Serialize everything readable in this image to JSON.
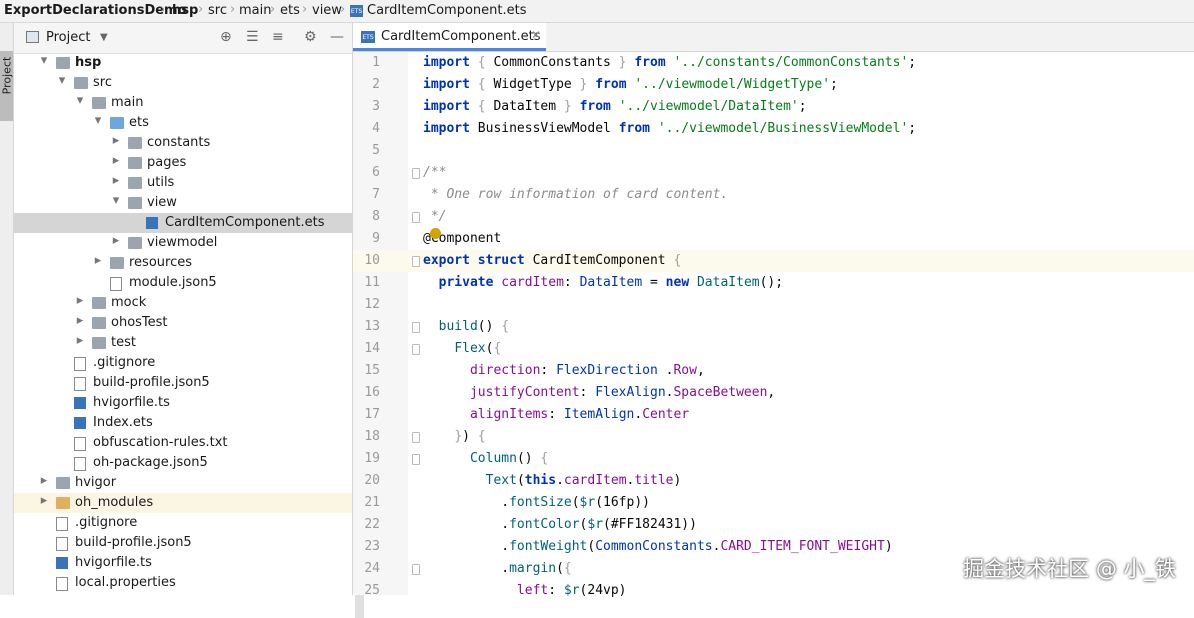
{
  "breadcrumb": [
    "ExportDeclarationsDemo",
    "hsp",
    "src",
    "main",
    "ets",
    "view",
    "CardItemComponent.ets"
  ],
  "side_strip": {
    "label": "Project"
  },
  "project_panel": {
    "title": "Project",
    "tree": [
      {
        "label": "hsp",
        "depth": 1,
        "expanded": true,
        "type": "folder",
        "bold": true
      },
      {
        "label": "src",
        "depth": 2,
        "expanded": true,
        "type": "folder"
      },
      {
        "label": "main",
        "depth": 3,
        "expanded": true,
        "type": "folder"
      },
      {
        "label": "ets",
        "depth": 4,
        "expanded": true,
        "type": "folder-blue"
      },
      {
        "label": "constants",
        "depth": 5,
        "expanded": false,
        "type": "folder"
      },
      {
        "label": "pages",
        "depth": 5,
        "expanded": false,
        "type": "folder"
      },
      {
        "label": "utils",
        "depth": 5,
        "expanded": false,
        "type": "folder"
      },
      {
        "label": "view",
        "depth": 5,
        "expanded": true,
        "type": "folder"
      },
      {
        "label": "CardItemComponent.ets",
        "depth": 6,
        "type": "ets",
        "selected": true
      },
      {
        "label": "viewmodel",
        "depth": 5,
        "expanded": false,
        "type": "folder"
      },
      {
        "label": "resources",
        "depth": 4,
        "expanded": false,
        "type": "folder"
      },
      {
        "label": "module.json5",
        "depth": 4,
        "type": "file"
      },
      {
        "label": "mock",
        "depth": 3,
        "expanded": false,
        "type": "folder"
      },
      {
        "label": "ohosTest",
        "depth": 3,
        "expanded": false,
        "type": "folder"
      },
      {
        "label": "test",
        "depth": 3,
        "expanded": false,
        "type": "folder"
      },
      {
        "label": ".gitignore",
        "depth": 2,
        "type": "file"
      },
      {
        "label": "build-profile.json5",
        "depth": 2,
        "type": "file"
      },
      {
        "label": "hvigorfile.ts",
        "depth": 2,
        "type": "ts"
      },
      {
        "label": "Index.ets",
        "depth": 2,
        "type": "ets"
      },
      {
        "label": "obfuscation-rules.txt",
        "depth": 2,
        "type": "file"
      },
      {
        "label": "oh-package.json5",
        "depth": 2,
        "type": "file"
      },
      {
        "label": "hvigor",
        "depth": 1,
        "expanded": false,
        "type": "folder"
      },
      {
        "label": "oh_modules",
        "depth": 1,
        "expanded": false,
        "type": "folder-orange",
        "highlight": true
      },
      {
        "label": ".gitignore",
        "depth": 1,
        "type": "file"
      },
      {
        "label": "build-profile.json5",
        "depth": 1,
        "type": "file"
      },
      {
        "label": "hvigorfile.ts",
        "depth": 1,
        "type": "ts"
      },
      {
        "label": "local.properties",
        "depth": 1,
        "type": "file"
      }
    ]
  },
  "editor": {
    "tab_label": "CardItemComponent.ets",
    "current_line": 10,
    "lines": [
      [
        [
          "kw",
          "import"
        ],
        [
          "brk",
          " { "
        ],
        [
          "",
          "CommonConstants"
        ],
        [
          "brk",
          " } "
        ],
        [
          "kw",
          "from "
        ],
        [
          "str",
          "'../constants/CommonConstants'"
        ],
        [
          "",
          ";"
        ]
      ],
      [
        [
          "kw",
          "import"
        ],
        [
          "brk",
          " { "
        ],
        [
          "",
          "WidgetType"
        ],
        [
          "brk",
          " } "
        ],
        [
          "kw",
          "from "
        ],
        [
          "str",
          "'../viewmodel/WidgetType'"
        ],
        [
          "",
          ";"
        ]
      ],
      [
        [
          "kw",
          "import"
        ],
        [
          "brk",
          " { "
        ],
        [
          "",
          "DataItem"
        ],
        [
          "brk",
          " } "
        ],
        [
          "kw",
          "from "
        ],
        [
          "str",
          "'../viewmodel/DataItem'"
        ],
        [
          "",
          ";"
        ]
      ],
      [
        [
          "kw",
          "import "
        ],
        [
          "",
          "BusinessViewModel "
        ],
        [
          "kw",
          "from "
        ],
        [
          "str",
          "'../viewmodel/BusinessViewModel'"
        ],
        [
          "",
          ";"
        ]
      ],
      [],
      [
        [
          "cmt",
          "/**"
        ]
      ],
      [
        [
          "cmt",
          " * One row information of card content."
        ]
      ],
      [
        [
          "cmt",
          " */"
        ]
      ],
      [
        [
          "",
          "@Component"
        ]
      ],
      [
        [
          "kw",
          "export struct "
        ],
        [
          "",
          "CardItemComponent "
        ],
        [
          "brk",
          "{"
        ]
      ],
      [
        [
          "",
          "  "
        ],
        [
          "kw",
          "private "
        ],
        [
          "prop",
          "cardItem"
        ],
        [
          "",
          ": "
        ],
        [
          "typ",
          "DataItem"
        ],
        [
          "",
          " = "
        ],
        [
          "kw",
          "new "
        ],
        [
          "fn",
          "DataItem"
        ],
        [
          "",
          "();"
        ]
      ],
      [],
      [
        [
          "",
          "  "
        ],
        [
          "fn",
          "build"
        ],
        [
          "",
          "() "
        ],
        [
          "brk",
          "{"
        ]
      ],
      [
        [
          "",
          "    "
        ],
        [
          "fn",
          "Flex"
        ],
        [
          "",
          "("
        ],
        [
          "brk",
          "{"
        ]
      ],
      [
        [
          "",
          "      "
        ],
        [
          "prop",
          "direction"
        ],
        [
          "",
          ": "
        ],
        [
          "typ",
          "FlexDirection"
        ],
        [
          "",
          " ."
        ],
        [
          "prop",
          "Row"
        ],
        [
          "",
          ","
        ]
      ],
      [
        [
          "",
          "      "
        ],
        [
          "prop",
          "justifyContent"
        ],
        [
          "",
          ": "
        ],
        [
          "typ",
          "FlexAlign"
        ],
        [
          "",
          "."
        ],
        [
          "prop",
          "SpaceBetween"
        ],
        [
          "",
          ","
        ]
      ],
      [
        [
          "",
          "      "
        ],
        [
          "prop",
          "alignItems"
        ],
        [
          "",
          ": "
        ],
        [
          "typ",
          "ItemAlign"
        ],
        [
          "",
          "."
        ],
        [
          "prop",
          "Center"
        ]
      ],
      [
        [
          "",
          "    "
        ],
        [
          "brk",
          "}"
        ],
        [
          ") "
        ],
        [
          "brk",
          "{"
        ]
      ],
      [
        [
          "",
          "      "
        ],
        [
          "fn",
          "Column"
        ],
        [
          "",
          "() "
        ],
        [
          "brk",
          "{"
        ]
      ],
      [
        [
          "",
          "        "
        ],
        [
          "fn",
          "Text"
        ],
        [
          "",
          "("
        ],
        [
          "kw",
          "this"
        ],
        [
          "",
          "."
        ],
        [
          "prop",
          "cardItem"
        ],
        [
          "",
          "."
        ],
        [
          "prop",
          "title"
        ],
        [
          "",
          ")"
        ]
      ],
      [
        [
          "",
          "          ."
        ],
        [
          "fn",
          "fontSize"
        ],
        [
          "",
          "("
        ],
        [
          "fn",
          "$r"
        ],
        [
          "",
          "(16fp))"
        ]
      ],
      [
        [
          "",
          "          ."
        ],
        [
          "fn",
          "fontColor"
        ],
        [
          "",
          "("
        ],
        [
          "fn",
          "$r"
        ],
        [
          "",
          "(#FF182431))"
        ]
      ],
      [
        [
          "",
          "          ."
        ],
        [
          "fn",
          "fontWeight"
        ],
        [
          "",
          "("
        ],
        [
          "typ",
          "CommonConstants"
        ],
        [
          "",
          "."
        ],
        [
          "prop",
          "CARD_ITEM_FONT_WEIGHT"
        ],
        [
          "",
          ")"
        ]
      ],
      [
        [
          "",
          "          ."
        ],
        [
          "fn",
          "margin"
        ],
        [
          "",
          "("
        ],
        [
          "brk",
          "{"
        ]
      ],
      [
        [
          "",
          "            "
        ],
        [
          "prop",
          "left"
        ],
        [
          "",
          ": "
        ],
        [
          "fn",
          "$r"
        ],
        [
          "",
          "(24vp)"
        ]
      ]
    ]
  },
  "watermark": "掘金技术社区 @ 小_铁"
}
